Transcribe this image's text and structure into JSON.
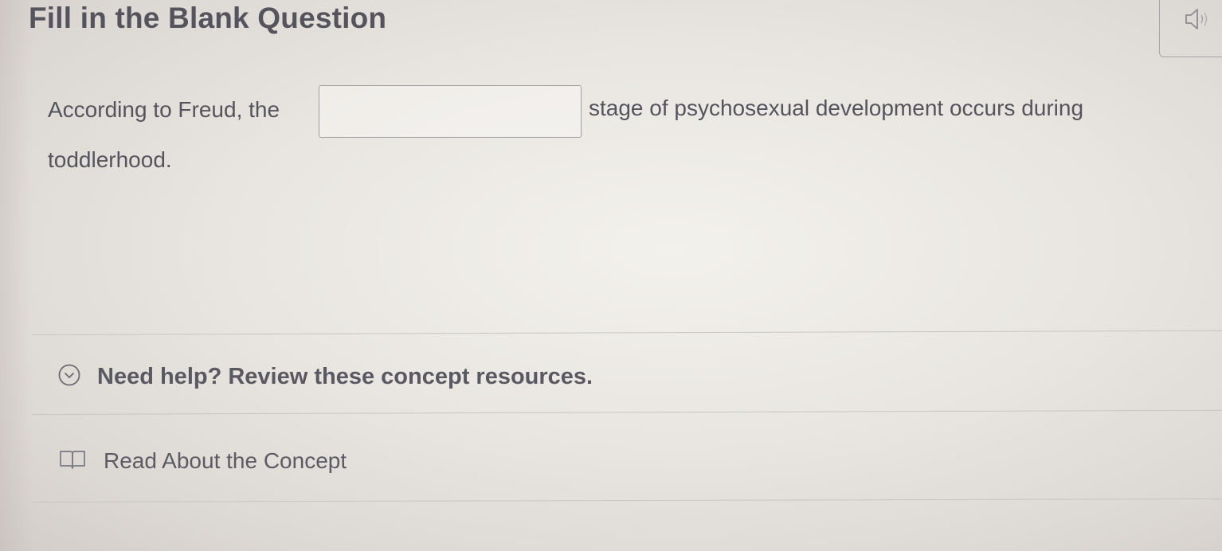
{
  "header": {
    "title": "Fill in the Blank Question",
    "audio_icon": "speaker-icon"
  },
  "question": {
    "text_before": "According to Freud, the",
    "text_after": "stage of psychosexual development occurs during",
    "text_continued": "toddlerhood.",
    "blank_value": ""
  },
  "resources": {
    "toggle_icon": "chevron-down-circle-icon",
    "help_label": "Need help? Review these concept resources.",
    "read_icon": "book-icon",
    "read_label": "Read About the Concept"
  }
}
